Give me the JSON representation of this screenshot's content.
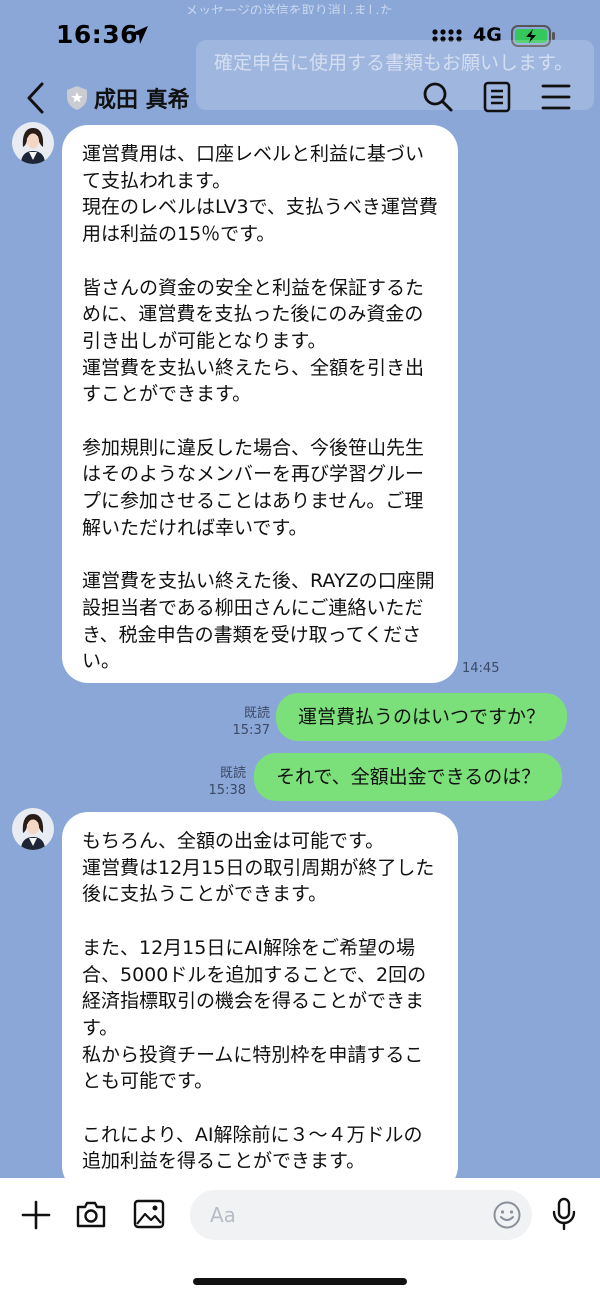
{
  "status_bar": {
    "time": "16:36",
    "network": "4G",
    "ghost_preview": "メッセージの送信を取り消しました"
  },
  "ghost_banner": {
    "text": "確定申告に使用する書類もお願いします。"
  },
  "header": {
    "title": "成田 真希"
  },
  "messages": [
    {
      "text": "運営費用は、口座レベルと利益に基づいて支払われます。\n現在のレベルはLV3で、支払うべき運営費用は利益の15％です。\n\n皆さんの資金の安全と利益を保証するために、運営費を支払った後にのみ資金の引き出しが可能となります。\n運営費を支払い終えたら、全額を引き出すことができます。\n\n参加規則に違反した場合、今後笹山先生はそのようなメンバーを再び学習グループに参加させることはありません。ご理解いただければ幸いです。\n\n運営費を支払い終えた後、RAYZの口座開設担当者である柳田さんにご連絡いただき、税金申告の書類を受け取ってください。",
      "time": "14:45"
    },
    {
      "text": "運営費払うのはいつですか？",
      "read": "既読",
      "time": "15:37"
    },
    {
      "text": "それで、全額出金できるのは？",
      "read": "既読",
      "time": "15:38"
    },
    {
      "text": "もちろん、全額の出金は可能です。\n運営費は12月15日の取引周期が終了した後に支払うことができます。\n\nまた、12月15日にAI解除をご希望の場合、5000ドルを追加することで、2回の経済指標取引の機会を得ることができます。\n私から投資チームに特別枠を申請することも可能です。\n\nこれにより、AI解除前に３〜４万ドルの追加利益を得ることができます。"
    }
  ],
  "input": {
    "placeholder": "Aa"
  },
  "colors": {
    "background": "#8aa7d8",
    "outgoing_bubble": "#7be07a",
    "incoming_bubble": "#ffffff"
  }
}
